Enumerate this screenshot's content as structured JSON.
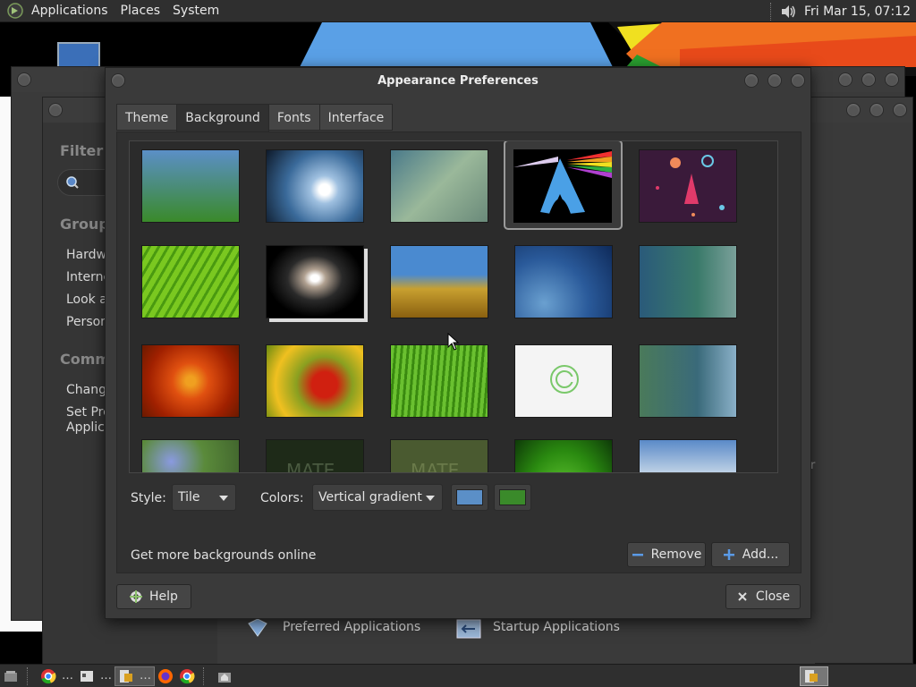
{
  "top_panel": {
    "menus": [
      "Applications",
      "Places",
      "System"
    ],
    "clock": "Fri Mar 15, 07:12"
  },
  "control_center": {
    "filter_label": "Filter",
    "groups_heading": "Groups",
    "groups": [
      "Hardwa",
      "Interne",
      "Look ar",
      "Person"
    ],
    "common_heading": "Comme",
    "common": [
      "Change",
      "Set Pre",
      "Applica"
    ],
    "bottom_items": [
      "Preferred Applications",
      "Startup Applications"
    ]
  },
  "dialog": {
    "title": "Appearance Preferences",
    "tabs": [
      "Theme",
      "Background",
      "Fonts",
      "Interface"
    ],
    "active_tab": "Background",
    "style_label": "Style:",
    "style_value": "Tile",
    "colors_label": "Colors:",
    "colors_value": "Vertical gradient",
    "primary_color": "#5b8fc7",
    "secondary_color": "#3a8a2a",
    "more_online": "Get more backgrounds online",
    "remove_label": "Remove",
    "add_label": "Add...",
    "help_label": "Help",
    "close_label": "Close"
  },
  "icons": {
    "volume": "volume-icon",
    "help": "help-icon",
    "remove": "minus-icon",
    "add": "plus-icon",
    "close": "close-icon"
  }
}
